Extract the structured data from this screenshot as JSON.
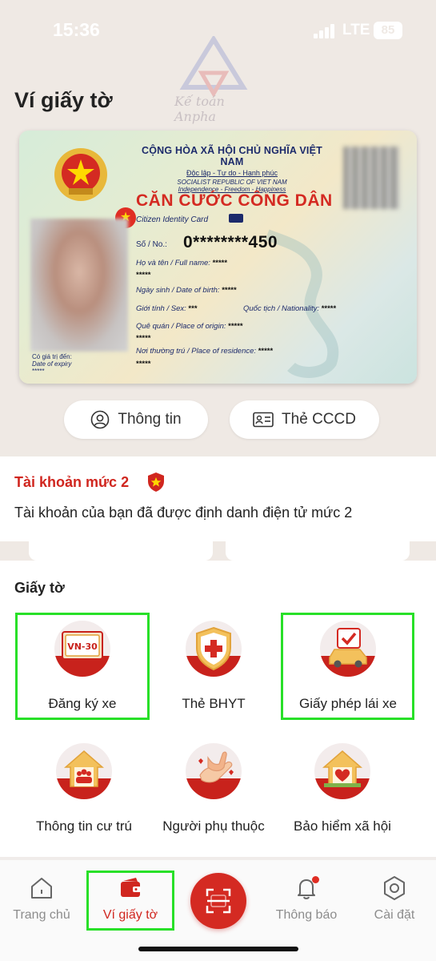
{
  "status_bar": {
    "time": "15:36",
    "network": "LTE",
    "battery": "85"
  },
  "header": {
    "title": "Ví giấy tờ",
    "watermark": "Kế toán Anpha"
  },
  "id_card": {
    "country": "CỘNG HÒA XÃ HỘI CHỦ NGHĨA VIỆT NAM",
    "motto": "Độc lập - Tự do - Hạnh phúc",
    "country_en": "SOCIALIST REPUBLIC OF VIET NAM",
    "motto_en": "Independence - Freedom - Happiness",
    "card_title": "CĂN CƯỚC CÔNG DÂN",
    "card_title_en": "Citizen Identity Card",
    "no_label": "Số / No.:",
    "no_value": "0********450",
    "name_label": "Họ và tên / Full name:",
    "name_value": "*****",
    "name_value2": "*****",
    "dob_label": "Ngày sinh / Date of birth:",
    "dob_value": "*****",
    "sex_label": "Giới tính / Sex:",
    "sex_value": "***",
    "nationality_label": "Quốc tịch / Nationality:",
    "nationality_value": "*****",
    "hometown_label": "Quê quán / Place of origin:",
    "hometown_value": "*****",
    "hometown_value2": "*****",
    "residence_label": "Nơi thường trú / Place of residence:",
    "residence_value": "*****",
    "residence_value2": "*****",
    "expiry_label": "Có giá trị đến:",
    "expiry_label_en": "Date of expiry",
    "expiry_value": "*****"
  },
  "actions": {
    "info": "Thông tin",
    "card": "Thẻ CCCD"
  },
  "account": {
    "level_title": "Tài khoản mức 2",
    "level_desc": "Tài khoản của bạn đã được định danh điện tử mức 2"
  },
  "documents": {
    "section_title": "Giấy tờ",
    "plate_text": "VN-30",
    "items": [
      {
        "label": "Đăng ký xe",
        "icon": "vehicle-registration-icon",
        "highlighted": true
      },
      {
        "label": "Thẻ BHYT",
        "icon": "health-insurance-icon",
        "highlighted": false
      },
      {
        "label": "Giấy phép lái xe",
        "icon": "driving-license-icon",
        "highlighted": true
      },
      {
        "label": "Thông tin cư trú",
        "icon": "residence-icon",
        "highlighted": false
      },
      {
        "label": "Người phụ thuộc",
        "icon": "dependents-icon",
        "highlighted": false
      },
      {
        "label": "Bảo hiểm xã hội",
        "icon": "social-insurance-icon",
        "highlighted": false
      }
    ]
  },
  "tabbar": {
    "items": [
      {
        "label": "Trang chủ",
        "icon": "home-icon",
        "active": false
      },
      {
        "label": "Ví giấy tờ",
        "icon": "wallet-icon",
        "active": true
      },
      {
        "label": "Quét",
        "icon": "scan-icon",
        "active": false
      },
      {
        "label": "Thông báo",
        "icon": "bell-icon",
        "active": false
      },
      {
        "label": "Cài đặt",
        "icon": "settings-icon",
        "active": false
      }
    ]
  },
  "colors": {
    "brand_red": "#d0261f",
    "highlight_green": "#28e028",
    "top_bg": "#efe9e4"
  }
}
